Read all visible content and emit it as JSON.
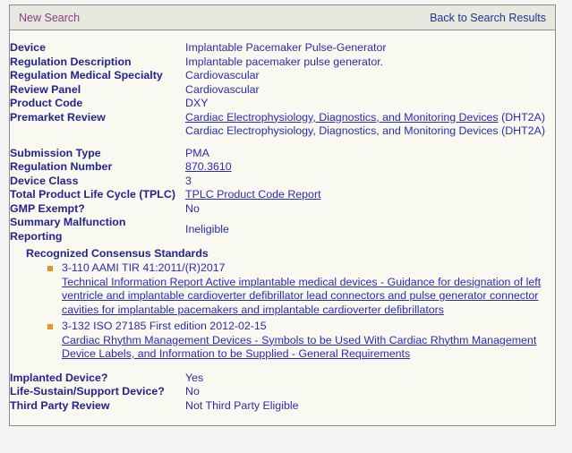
{
  "topbar": {
    "new_search": "New Search",
    "back_to_results": "Back to Search Results"
  },
  "details": {
    "device_label": "Device",
    "device_value": "Implantable Pacemaker Pulse-Generator",
    "regulation_description_label": "Regulation Description",
    "regulation_description_value": "Implantable pacemaker pulse generator.",
    "regulation_medical_specialty_label": "Regulation Medical Specialty",
    "regulation_medical_specialty_value": "Cardiovascular",
    "review_panel_label": "Review Panel",
    "review_panel_value": "Cardiovascular",
    "product_code_label": "Product Code",
    "product_code_value": "DXY",
    "premarket_review_label": "Premarket Review",
    "premarket_review_link_1": "Cardiac Electrophysiology, Diagnostics, and Monitoring Devices",
    "premarket_review_suffix_1": " (DHT2A)",
    "premarket_review_line_2": "Cardiac Electrophysiology, Diagnostics, and Monitoring Devices (DHT2A)",
    "submission_type_label": "Submission Type",
    "submission_type_value": "PMA",
    "regulation_number_label": "Regulation Number",
    "regulation_number_value": "870.3610",
    "device_class_label": "Device Class",
    "device_class_value": "3",
    "tplc_label": "Total Product Life Cycle (TPLC)",
    "tplc_value": "TPLC Product Code Report",
    "gmp_exempt_label": "GMP Exempt?",
    "gmp_exempt_value": "No",
    "summary_malfunction_label": "Summary Malfunction Reporting",
    "summary_malfunction_label_line1": "Summary Malfunction",
    "summary_malfunction_label_line2": "Reporting",
    "summary_malfunction_value": "Ineligible",
    "implanted_device_label": "Implanted Device?",
    "implanted_device_value": "Yes",
    "life_sustain_label": "Life-Sustain/Support Device?",
    "life_sustain_value": "No",
    "third_party_review_label": "Third Party Review",
    "third_party_review_value": "Not Third Party Eligible"
  },
  "standards": {
    "title": "Recognized Consensus Standards",
    "items": [
      {
        "code": "3-110 AAMI TIR 41:2011/(R)2017",
        "description": "Technical Information Report Active implantable medical devices - Guidance for designation of left ventricle and implantable cardioverter defibrillator lead connectors and pulse generator connector cavities for implantable pacemakers and implantable cardioverter defibrillators"
      },
      {
        "code": "3-132 ISO 27185 First edition 2012-02-15",
        "description": "Cardiac Rhythm Management Devices - Symbols to be Used With Cardiac Rhythm Management Device Labels, and Information to be Supplied - General Requirements"
      }
    ]
  },
  "colors": {
    "label_text": "#24248c",
    "value_text": "#2b2bad",
    "link": "#2a2aba",
    "new_search_link": "#8c3a80",
    "bullet": "#e8921f",
    "panel_background": "#f9f9f1",
    "topbar_background": "#e7e9e1",
    "page_background": "#f4f4f4",
    "border": "#8b8b8b"
  }
}
